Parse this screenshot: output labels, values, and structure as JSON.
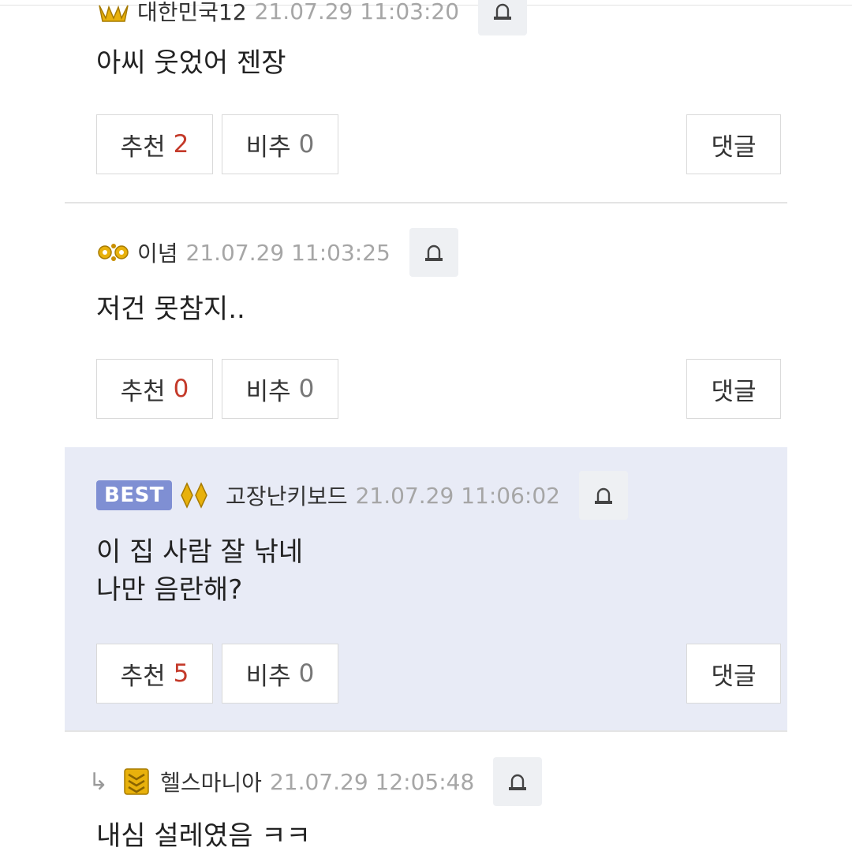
{
  "comments": [
    {
      "author": "대한민국12",
      "date": "21.07.29 11:03:20",
      "body": [
        "아씨 웃었어 젠장"
      ],
      "upvote_label": "추천",
      "upvotes": "2",
      "downvote_label": "비추",
      "downvotes": "0",
      "reply_label": "댓글",
      "level_icon": "gold-crown-icon"
    },
    {
      "author": "이념",
      "date": "21.07.29 11:03:25",
      "body": [
        "저건 못참지.."
      ],
      "upvote_label": "추천",
      "upvotes": "0",
      "downvote_label": "비추",
      "downvotes": "0",
      "reply_label": "댓글",
      "level_icon": "gold-gears-icon"
    },
    {
      "badge": "BEST",
      "author": "고장난키보드",
      "date": "21.07.29 11:06:02",
      "body": [
        "이 집 사람 잘 낚네",
        "나만 음란해?"
      ],
      "upvote_label": "추천",
      "upvotes": "5",
      "downvote_label": "비추",
      "downvotes": "0",
      "reply_label": "댓글",
      "level_icon": "gold-diamond-icon",
      "background": "#e8ebf6"
    },
    {
      "is_reply": true,
      "author": "헬스마니아",
      "date": "21.07.29 12:05:48",
      "body": [
        "내심 설레였음 ㅋㅋ"
      ],
      "level_icon": "gold-chevron-rank-icon"
    }
  ],
  "colors": {
    "upvote_count": "#c43a2a",
    "best_badge": "#7f8fd3",
    "date_text": "#a6a6a6",
    "report_button_bg": "#eef0f3"
  },
  "icons": {
    "report": "siren-icon",
    "reply_arrow": "reply-arrow-icon"
  }
}
